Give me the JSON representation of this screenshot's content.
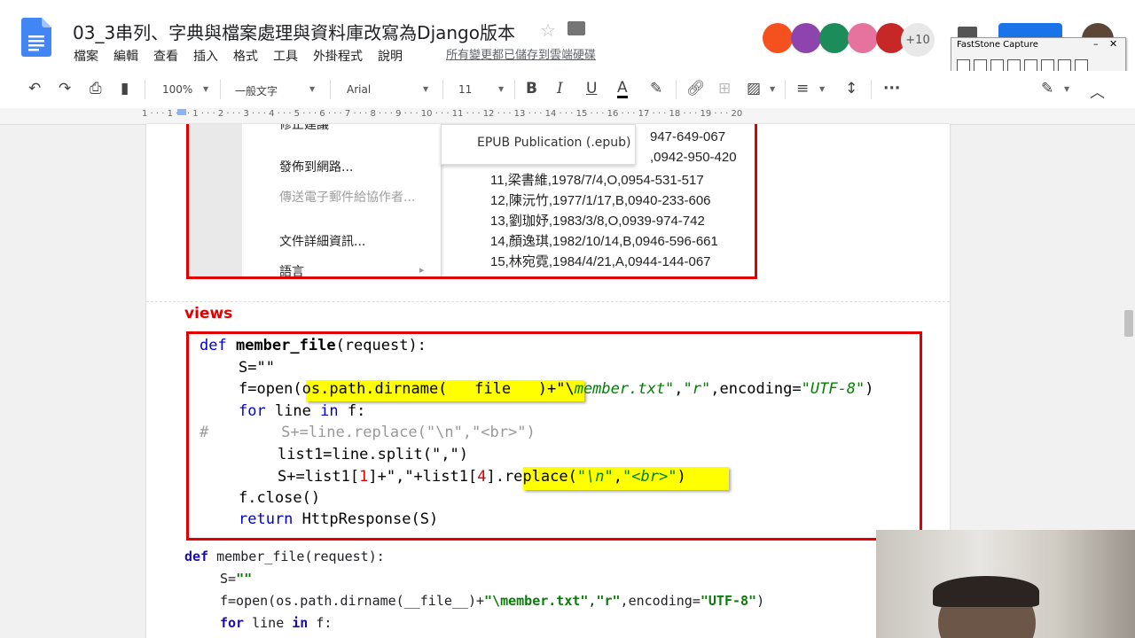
{
  "app": {
    "doc_title": "03_3串列、字典與檔案處理與資料庫改寫為Django版本",
    "menus": [
      "檔案",
      "編輯",
      "查看",
      "插入",
      "格式",
      "工具",
      "外掛程式",
      "說明"
    ],
    "save_status": "所有變更都已儲存到雲端硬碟",
    "collaborators_more": "+10",
    "colors": {
      "accent": "#1a73e8",
      "annotation_red": "#e00000",
      "highlight": "#ffff00"
    }
  },
  "faststone": {
    "title": "FastStone Capture",
    "minimize": "–",
    "close": "✕"
  },
  "toolbar": {
    "zoom": "100%",
    "style": "一般文字",
    "font": "Arial",
    "size": "11",
    "bold": "B",
    "italic": "I",
    "underline": "U",
    "text_color": "A",
    "more": "···"
  },
  "ruler": {
    "text": "1 · · · 1 · · · 1 · · · 2 · · · 3 · · · 4 · · · 5 · · · 6 · · · 7 · · · 8 · · · 9 · · · 10 · · · 11 · · · 12 · · · 13 · · · 14 · · · 15 · · · 16 · · · 17 · · · 18 · · · 19 · · · 20"
  },
  "screenshot_menu": {
    "items": [
      {
        "label": "修正建議",
        "disabled": false
      },
      {
        "label": "發佈到網路...",
        "disabled": false
      },
      {
        "label": "傳送電子郵件給協作者...",
        "disabled": true
      },
      {
        "label": "文件詳細資訊...",
        "disabled": false
      },
      {
        "label": "語言",
        "disabled": false
      }
    ],
    "submenu_item": "EPUB Publication (.epub)",
    "submenu_arrow": "▸",
    "member_rows": [
      "947-649-067",
      ",0942-950-420",
      "11,梁書維,1978/7/4,O,0954-531-517",
      "12,陳沅竹,1977/1/17,B,0940-233-606",
      "13,劉珈妤,1983/3/8,O,0939-974-742",
      "14,顏逸琪,1982/10/14,B,0946-596-661",
      "15,林宛霓,1984/4/21,A,0944-144-067"
    ]
  },
  "views_label": "views",
  "code_screenshot": {
    "l1_kw": "def",
    "l1_fn": "member_file",
    "l1_rest": "(request):",
    "l2": "S=\"\"",
    "l3_a": "f=open(",
    "l3_hl": "os.path.dirname(   file   )+\"\\",
    "l3_str": "member.txt\"",
    "l3_b": ",",
    "l3_str2": "\"r\"",
    "l3_c": ",encoding=",
    "l3_str3": "\"UTF-8\"",
    "l3_d": ")",
    "l4_kw": "for",
    "l4_a": " line ",
    "l4_kw2": "in",
    "l4_b": " f:",
    "l5": "#        S+=line.replace(\"\\n\",\"<br>\")",
    "l6": "list1=line.split(\",\")",
    "l7_a": "S+=list1[",
    "l7_n1": "1",
    "l7_b": "]+\",\"+list1[",
    "l7_n2": "4",
    "l7_c": "].",
    "l7_hl_a": "replace(",
    "l7_hl_s1": "\"\\n\"",
    "l7_hl_b": ",",
    "l7_hl_s2": "\"<br>\"",
    "l7_hl_c": ")",
    "l8": "f.close()",
    "l9_kw": "return",
    "l9_rest": " HttpResponse(S)"
  },
  "code_plain": {
    "l1_kw": "def",
    "l1_rest": " member_file(request):",
    "l2_a": "S=",
    "l2_s": "\"\"",
    "l3_a": "f=open(os.path.dirname(__file__)+",
    "l3_s1": "\"\\member.txt\"",
    "l3_b": ",",
    "l3_s2": "\"r\"",
    "l3_c": ",encoding=",
    "l3_s3": "\"UTF-8\"",
    "l3_d": ")",
    "l4_kw": "for",
    "l4_a": " line ",
    "l4_kw2": "in",
    "l4_b": " f:"
  }
}
